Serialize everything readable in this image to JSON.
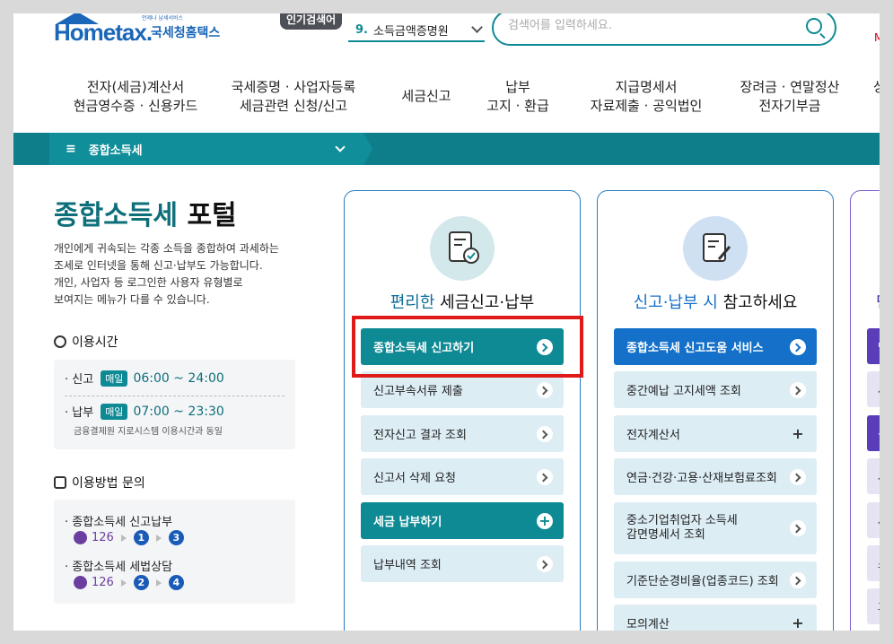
{
  "header": {
    "logo_text": "Hometax.",
    "logo_kr": "국세청홈택스",
    "logo_sub": "언제나 납세서비스",
    "popular_tag": "인기검색어",
    "popular_num": "9.",
    "popular_term": "소득금액증명원",
    "search_placeholder": "검색어를 입력하세요.",
    "my_link": "My"
  },
  "nav": [
    {
      "l1": "전자(세금)계산서",
      "l2": "현금영수증 · 신용카드"
    },
    {
      "l1": "국세증명 · 사업자등록",
      "l2": "세금관련 신청/신고"
    },
    {
      "l1": "세금신고",
      "l2": ""
    },
    {
      "l1": "납부",
      "l2": "고지 · 환급"
    },
    {
      "l1": "지급명세서",
      "l2": "자료제출 · 공익법인"
    },
    {
      "l1": "장려금 · 연말정산",
      "l2": "전자기부금"
    },
    {
      "l1": "상담",
      "l2": ""
    }
  ],
  "breadcrumb": {
    "menu_icon": "≡",
    "label": "종합소득세"
  },
  "portal": {
    "title_a": "종합소득세",
    "title_b": "포털",
    "desc": [
      "개인에게 귀속되는 각종 소득을 종합하여 과세하는",
      "조세로 인터넷을 통해 신고·납부도 가능합니다.",
      "개인, 사업자 등 로그인한 사용자 유형별로",
      "보여지는 메뉴가 다를 수 있습니다."
    ]
  },
  "hours": {
    "heading": "이용시간",
    "r1_label": "· 신고",
    "r1_badge": "매일",
    "r1_time": "06:00 ~ 24:00",
    "r2_label": "· 납부",
    "r2_badge": "매일",
    "r2_time": "07:00 ~ 23:30",
    "note": "금융결제원 지로시스템 이용시간과 동일"
  },
  "inquiry": {
    "heading": "이용방법 문의",
    "i1_label": "· 종합소득세 신고납부",
    "i1_num": "126",
    "i1_a": "1",
    "i1_b": "3",
    "i2_label": "· 종합소득세 세법상담",
    "i2_num": "126",
    "i2_a": "2",
    "i2_b": "4"
  },
  "card1": {
    "title_hl": "편리한",
    "title_rest": "세금신고·납부",
    "b0": "종합소득세 신고하기",
    "b1": "신고부속서류 제출",
    "b2": "전자신고 결과 조회",
    "b3": "신고서 삭제 요청",
    "b4": "세금 납부하기",
    "b5": "납부내역 조회"
  },
  "card2": {
    "title_hl": "신고·납부 시",
    "title_rest": "참고하세요",
    "b0": "종합소득세 신고도움 서비스",
    "b1": "중간예납 고지세액 조회",
    "b2": "전자계산서",
    "b3": "연금·건강·고용·산재보험료조회",
    "b4_l1": "중소기업취업자 소득세",
    "b4_l2": "감면명세서 조회",
    "b5": "기준단순경비율(업종코드) 조회",
    "b6": "모의계산"
  },
  "card3": {
    "title": "민",
    "b0": "민",
    "b1": "세",
    "b2": "신",
    "b3": "사",
    "b4": "사",
    "b5": "소",
    "b6": "과"
  },
  "colors": {
    "teal": "#0e8a95",
    "blue": "#1470c8",
    "highlight": "#e01919",
    "purple": "#6b3fa0"
  }
}
